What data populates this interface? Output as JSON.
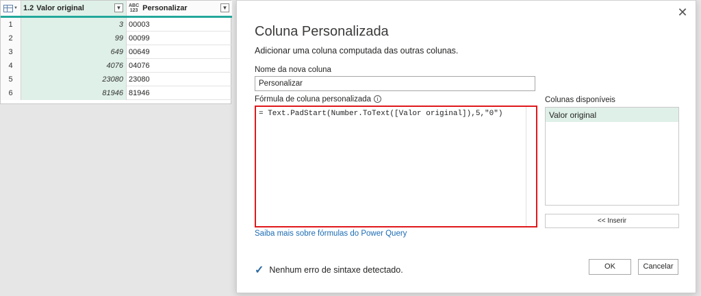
{
  "grid": {
    "header": {
      "col1": {
        "type_label": "1.2",
        "name": "Valor original"
      },
      "col2": {
        "type_label_top": "ABC",
        "type_label_bottom": "123",
        "name": "Personalizar"
      }
    },
    "rows": [
      {
        "n": "1",
        "v1": "3",
        "v2": "00003"
      },
      {
        "n": "2",
        "v1": "99",
        "v2": "00099"
      },
      {
        "n": "3",
        "v1": "649",
        "v2": "00649"
      },
      {
        "n": "4",
        "v1": "4076",
        "v2": "04076"
      },
      {
        "n": "5",
        "v1": "23080",
        "v2": "23080"
      },
      {
        "n": "6",
        "v1": "81946",
        "v2": "81946"
      }
    ]
  },
  "dialog": {
    "close_glyph": "✕",
    "title": "Coluna Personalizada",
    "subtitle": "Adicionar uma coluna computada das outras colunas.",
    "name_label": "Nome da nova coluna",
    "name_value": "Personalizar",
    "formula_label": "Fórmula de coluna personalizada",
    "info_glyph": "i",
    "formula": "= Text.PadStart(Number.ToText([Valor original]),5,\"0\")",
    "available_label": "Colunas disponíveis",
    "available_columns": [
      "Valor original"
    ],
    "insert_label": "<< Inserir",
    "learn_link": "Saiba mais sobre fórmulas do Power Query",
    "status": "Nenhum erro de sintaxe detectado.",
    "ok_label": "OK",
    "cancel_label": "Cancelar"
  },
  "colors": {
    "accent_teal": "#21a89a",
    "column_highlight": "#dff0e8",
    "formula_border": "#e0171a",
    "link": "#1b6bb3"
  }
}
